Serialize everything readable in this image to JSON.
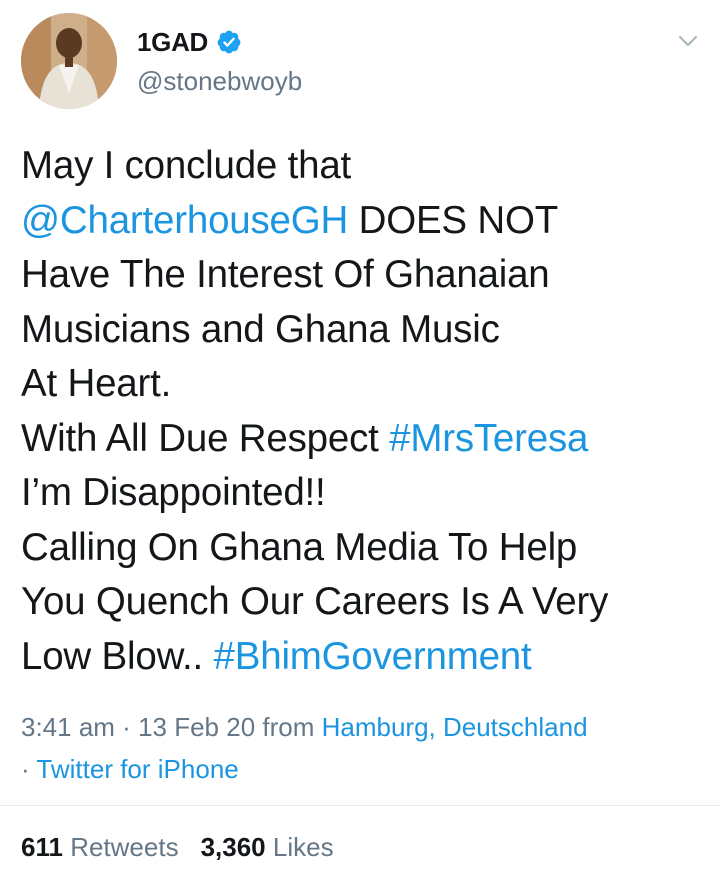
{
  "author": {
    "display_name": "1GAD",
    "handle": "@stonebwoyb",
    "avatar_icon": "profile-photo",
    "verified_icon": "verified-badge-icon",
    "menu_icon": "chevron-down-icon"
  },
  "tweet": {
    "lines": [
      [
        {
          "t": "May I conclude that"
        }
      ],
      [
        {
          "t": "@CharterhouseGH",
          "link": true
        },
        {
          "t": " DOES NOT"
        }
      ],
      [
        {
          "t": "Have The Interest Of Ghanaian"
        }
      ],
      [
        {
          "t": "Musicians and Ghana Music"
        }
      ],
      [
        {
          "t": "At Heart."
        }
      ],
      [
        {
          "t": "With All Due Respect "
        },
        {
          "t": "#MrsTeresa",
          "link": true
        }
      ],
      [
        {
          "t": "I’m Disappointed!!"
        }
      ],
      [
        {
          "t": "Calling On Ghana Media To Help"
        }
      ],
      [
        {
          "t": "You Quench Our Careers Is A Very"
        }
      ],
      [
        {
          "t": "Low Blow.. "
        },
        {
          "t": "#BhimGovernment",
          "link": true
        }
      ]
    ]
  },
  "meta": {
    "time": "3:41 am",
    "sep": " · ",
    "date": "13 Feb 20",
    "from_label": " from ",
    "location": "Hamburg, Deutschland",
    "sep2": "· ",
    "client": "Twitter for iPhone"
  },
  "stats": {
    "retweets_count": "611",
    "retweets_label": "Retweets",
    "likes_count": "3,360",
    "likes_label": "Likes"
  },
  "colors": {
    "link": "#1b95e0",
    "text": "#14171a",
    "secondary": "#657786",
    "divider": "#e6ecf0"
  }
}
